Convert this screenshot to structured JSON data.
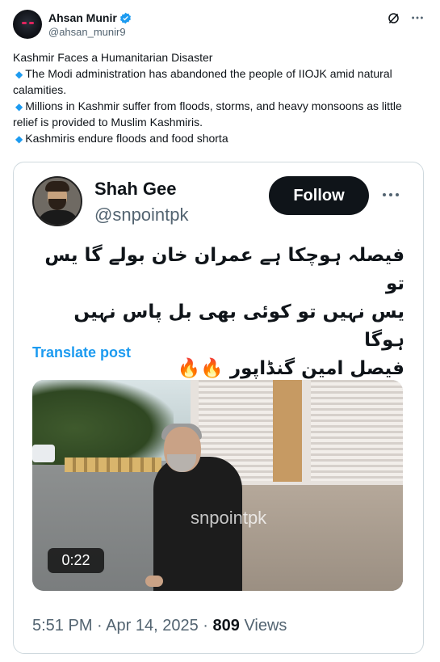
{
  "author": {
    "display_name": "Ahsan Munir",
    "handle": "@ahsan_munir9"
  },
  "tweet": {
    "lines": [
      {
        "bullet": false,
        "text": "Kashmir Faces a Humanitarian Disaster"
      },
      {
        "bullet": true,
        "text": "The Modi administration has abandoned the people of IIOJK amid natural calamities."
      },
      {
        "bullet": true,
        "text": "Millions in Kashmir suffer from floods, storms, and heavy monsoons as little relief is provided to Muslim Kashmiris."
      },
      {
        "bullet": true,
        "text": "Kashmiris endure floods and food shorta"
      }
    ]
  },
  "quoted": {
    "display_name": "Shah Gee",
    "handle": "@snpointpk",
    "follow_label": "Follow",
    "urdu_lines": [
      "فیصلہ ہوچکا ہے عمران خان بولے گا یس تو",
      "یس نہیں تو کوئی بھی بل پاس نہیں ہوگا",
      "فیصل امین گنڈاپور"
    ],
    "emojis": "🔥🔥",
    "translate_label": "Translate post",
    "video_watermark": "snpointpk",
    "video_duration": "0:22",
    "time": "5:51 PM",
    "separator": "·",
    "date": "Apr 14, 2025",
    "views_count": "809",
    "views_label": "Views"
  },
  "colors": {
    "text": "#0f1419",
    "secondary": "#536471",
    "accent": "#1d9bf0",
    "border": "#cfd9de"
  },
  "icons": {
    "verified": "verified-badge-icon",
    "grok": "grok-icon",
    "more": "more-horizontal-icon",
    "bullet": "blue-diamond-icon",
    "fire": "fire-emoji-icon"
  }
}
